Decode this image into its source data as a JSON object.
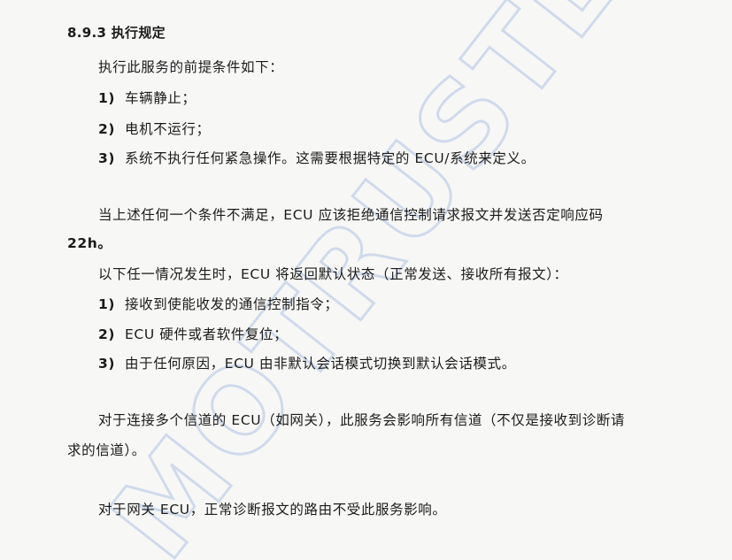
{
  "section": {
    "number": "8.9.3",
    "title": "执行规定"
  },
  "preconditions": {
    "intro": "执行此服务的前提条件如下：",
    "items": [
      {
        "num": "1)",
        "text": "车辆静止；"
      },
      {
        "num": "2)",
        "text": "电机不运行；"
      },
      {
        "num": "3)",
        "text": "系统不执行任何紧急操作。这需要根据特定的 ECU/系统来定义。"
      }
    ]
  },
  "rejection": {
    "line1": "当上述任何一个条件不满足，ECU 应该拒绝通信控制请求报文并发送否定响应码",
    "line2": "22h。"
  },
  "default_state": {
    "intro": "以下任一情况发生时，ECU 将返回默认状态（正常发送、接收所有报文）：",
    "items": [
      {
        "num": "1)",
        "text": "接收到使能收发的通信控制指令；"
      },
      {
        "num": "2)",
        "text": "ECU 硬件或者软件复位；"
      },
      {
        "num": "3)",
        "text": "由于任何原因，ECU 由非默认会话模式切换到默认会话模式。"
      }
    ]
  },
  "multichannel": {
    "line1": "对于连接多个信道的 ECU（如网关），此服务会影响所有信道（不仅是接收到诊断请",
    "line2": "求的信道）。"
  },
  "gateway": {
    "text": "对于网关 ECU，正常诊断报文的路由不受此服务影响。"
  },
  "watermark": {
    "text": "MOTRUSTECH",
    "color": "#c9d6ea"
  }
}
